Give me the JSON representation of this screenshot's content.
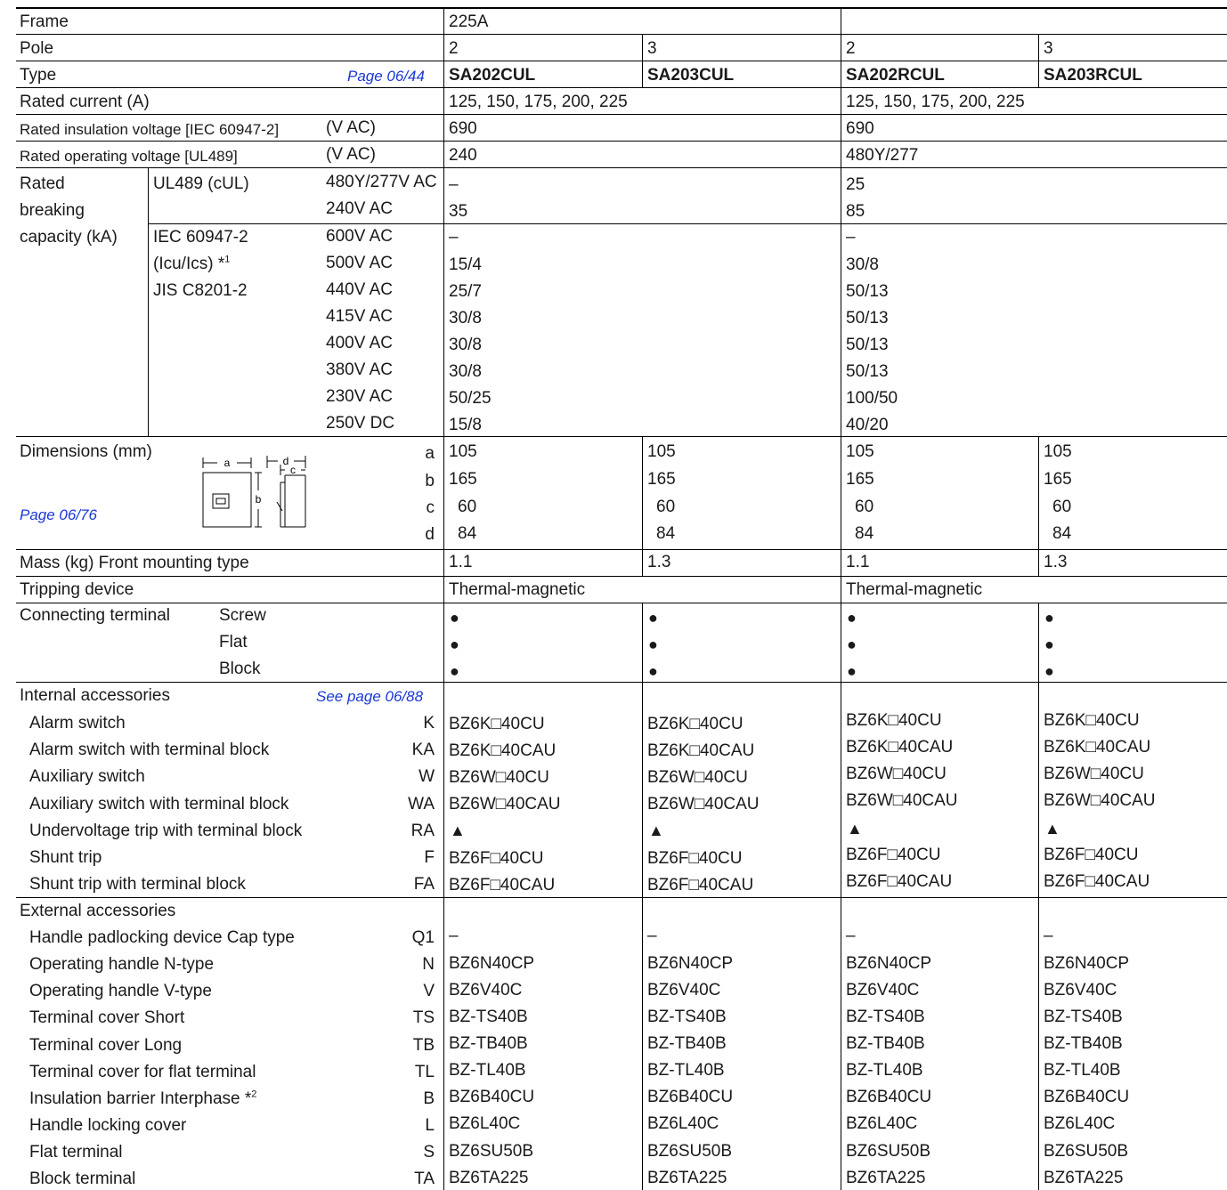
{
  "frame": {
    "label": "Frame",
    "value": "225A"
  },
  "pole": {
    "label": "Pole",
    "values": [
      "2",
      "3",
      "2",
      "3"
    ]
  },
  "type": {
    "label": "Type",
    "page_link": "Page 06/44",
    "values": [
      "SA202CUL",
      "SA203CUL",
      "SA202RCUL",
      "SA203RCUL"
    ]
  },
  "rated_current": {
    "label": "Rated current (A)",
    "left": "125, 150, 175, 200, 225",
    "right": "125, 150, 175, 200, 225"
  },
  "insulation_voltage": {
    "label": "Rated insulation voltage [IEC 60947-2]",
    "unit": "(V AC)",
    "left": "690",
    "right": "690"
  },
  "operating_voltage": {
    "label": "Rated operating voltage [UL489]",
    "unit": "(V AC)",
    "left": "240",
    "right": "480Y/277"
  },
  "breaking": {
    "label_1": "Rated",
    "label_2": "breaking",
    "label_3": "capacity (kA)",
    "ul_label": "UL489 (cUL)",
    "iec_1": "IEC 60947-2",
    "iec_2": "(Icu/Ics) *",
    "iec_sup": "1",
    "iec_3": "JIS C8201-2",
    "rows": [
      {
        "voltage": "480Y/277V AC",
        "left": "–",
        "right": "25"
      },
      {
        "voltage": "240V AC",
        "left": "35",
        "right": "85"
      },
      {
        "voltage": "600V AC",
        "left": "–",
        "right": "–"
      },
      {
        "voltage": "500V AC",
        "left": "15/4",
        "right": "30/8"
      },
      {
        "voltage": "440V AC",
        "left": "25/7",
        "right": "50/13"
      },
      {
        "voltage": "415V AC",
        "left": "30/8",
        "right": "50/13"
      },
      {
        "voltage": "400V AC",
        "left": "30/8",
        "right": "50/13"
      },
      {
        "voltage": "380V AC",
        "left": "30/8",
        "right": "50/13"
      },
      {
        "voltage": "230V AC",
        "left": "50/25",
        "right": "100/50"
      },
      {
        "voltage": "250V DC",
        "left": "15/8",
        "right": "40/20"
      }
    ]
  },
  "dimensions": {
    "label": "Dimensions (mm)",
    "page_link": "Page 06/76",
    "diagram_labels": {
      "a": "a",
      "b": "b",
      "c": "c",
      "d": "d"
    },
    "rows": [
      {
        "key": "a",
        "values": [
          "105",
          "105",
          "105",
          "105"
        ]
      },
      {
        "key": "b",
        "values": [
          "165",
          "165",
          "165",
          "165"
        ]
      },
      {
        "key": "c",
        "values": [
          "60",
          "60",
          "60",
          "60"
        ]
      },
      {
        "key": "d",
        "values": [
          "84",
          "84",
          "84",
          "84"
        ]
      }
    ]
  },
  "mass": {
    "label": "Mass (kg)  Front mounting type",
    "values": [
      "1.1",
      "1.3",
      "1.1",
      "1.3"
    ]
  },
  "tripping": {
    "label": "Tripping device",
    "left": "Thermal-magnetic",
    "right": "Thermal-magnetic"
  },
  "terminal": {
    "label": "Connecting terminal",
    "rows": [
      {
        "name": "Screw",
        "values": [
          "●",
          "●",
          "●",
          "●"
        ]
      },
      {
        "name": "Flat",
        "values": [
          "●",
          "●",
          "●",
          "●"
        ]
      },
      {
        "name": "Block",
        "values": [
          "●",
          "●",
          "●",
          "●"
        ]
      }
    ]
  },
  "internal": {
    "label": "Internal accessories",
    "page_link": "See page 06/88",
    "rows": [
      {
        "name": "Alarm switch",
        "code": "K",
        "values": [
          "BZ6K□40CU",
          "BZ6K□40CU",
          "BZ6K□40CU",
          "BZ6K□40CU"
        ]
      },
      {
        "name": "Alarm switch with terminal block",
        "code": "KA",
        "values": [
          "BZ6K□40CAU",
          "BZ6K□40CAU",
          "BZ6K□40CAU",
          "BZ6K□40CAU"
        ]
      },
      {
        "name": "Auxiliary switch",
        "code": "W",
        "values": [
          "BZ6W□40CU",
          "BZ6W□40CU",
          "BZ6W□40CU",
          "BZ6W□40CU"
        ]
      },
      {
        "name": "Auxiliary switch with terminal block",
        "code": "WA",
        "values": [
          "BZ6W□40CAU",
          "BZ6W□40CAU",
          "BZ6W□40CAU",
          "BZ6W□40CAU"
        ]
      },
      {
        "name": "Undervoltage trip with terminal block",
        "code": "RA",
        "values": [
          "▲",
          "▲",
          "▲",
          "▲"
        ]
      },
      {
        "name": "Shunt trip",
        "code": "F",
        "values": [
          "BZ6F□40CU",
          "BZ6F□40CU",
          "BZ6F□40CU",
          "BZ6F□40CU"
        ]
      },
      {
        "name": "Shunt trip with terminal block",
        "code": "FA",
        "values": [
          "BZ6F□40CAU",
          "BZ6F□40CAU",
          "BZ6F□40CAU",
          "BZ6F□40CAU"
        ]
      }
    ]
  },
  "external": {
    "label": "External accessories",
    "rows": [
      {
        "name": "Handle padlocking device  Cap type",
        "code": "Q1",
        "values": [
          "–",
          "–",
          "–",
          "–"
        ]
      },
      {
        "name": "Operating handle  N-type",
        "code": "N",
        "values": [
          "BZ6N40CP",
          "BZ6N40CP",
          "BZ6N40CP",
          "BZ6N40CP"
        ]
      },
      {
        "name": "Operating handle  V-type",
        "code": "V",
        "values": [
          "BZ6V40C",
          "BZ6V40C",
          "BZ6V40C",
          "BZ6V40C"
        ]
      },
      {
        "name": "Terminal cover  Short",
        "code": "TS",
        "values": [
          "BZ-TS40B",
          "BZ-TS40B",
          "BZ-TS40B",
          "BZ-TS40B"
        ]
      },
      {
        "name": "Terminal cover  Long",
        "code": "TB",
        "values": [
          "BZ-TB40B",
          "BZ-TB40B",
          "BZ-TB40B",
          "BZ-TB40B"
        ]
      },
      {
        "name": "Terminal cover for flat terminal",
        "code": "TL",
        "values": [
          "BZ-TL40B",
          "BZ-TL40B",
          "BZ-TL40B",
          "BZ-TL40B"
        ]
      },
      {
        "name": "Insulation barrier  Interphase *",
        "sup": "2",
        "code": "B",
        "values": [
          "BZ6B40CU",
          "BZ6B40CU",
          "BZ6B40CU",
          "BZ6B40CU"
        ]
      },
      {
        "name": "Handle locking cover",
        "code": "L",
        "values": [
          "BZ6L40C",
          "BZ6L40C",
          "BZ6L40C",
          "BZ6L40C"
        ]
      },
      {
        "name": "Flat terminal",
        "code": "S",
        "values": [
          "BZ6SU50B",
          "BZ6SU50B",
          "BZ6SU50B",
          "BZ6SU50B"
        ]
      },
      {
        "name": "Block terminal",
        "code": "TA",
        "values": [
          "BZ6TA225",
          "BZ6TA225",
          "BZ6TA225",
          "BZ6TA225"
        ]
      }
    ]
  }
}
